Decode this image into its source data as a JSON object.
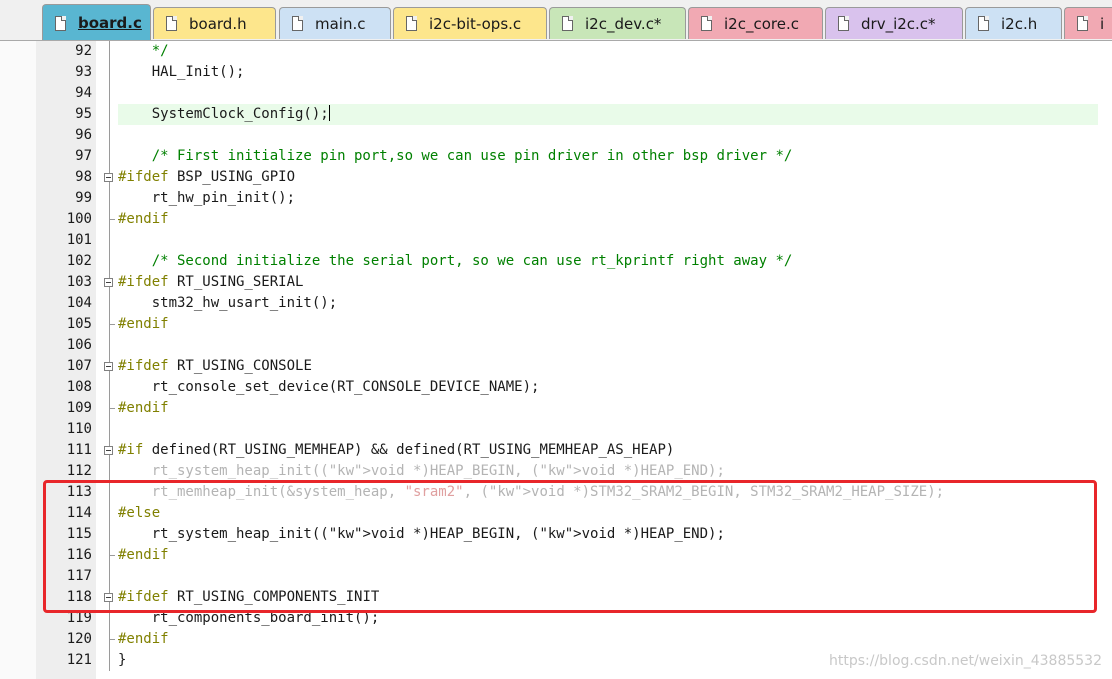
{
  "tabs": [
    {
      "label": "board.c",
      "active": true,
      "color": "#59b6d1"
    },
    {
      "label": "board.h",
      "active": false,
      "color": "#fde68c"
    },
    {
      "label": "main.c",
      "active": false,
      "color": "#cde1f4"
    },
    {
      "label": "i2c-bit-ops.c",
      "active": false,
      "color": "#fde68c"
    },
    {
      "label": "i2c_dev.c*",
      "active": false,
      "color": "#c8e6b8"
    },
    {
      "label": "i2c_core.c",
      "active": false,
      "color": "#f1a9b3"
    },
    {
      "label": "drv_i2c.c*",
      "active": false,
      "color": "#d9c2ed"
    },
    {
      "label": "i2c.h",
      "active": false,
      "color": "#cde1f4"
    },
    {
      "label": "i",
      "active": false,
      "color": "#f1a9b3"
    }
  ],
  "lines": [
    {
      "n": "92",
      "code": "    */"
    },
    {
      "n": "93",
      "code": "    HAL_Init();"
    },
    {
      "n": "94",
      "code": ""
    },
    {
      "n": "95",
      "code": "    SystemClock_Config();"
    },
    {
      "n": "96",
      "code": ""
    },
    {
      "n": "97",
      "code": "    /* First initialize pin port,so we can use pin driver in other bsp driver */"
    },
    {
      "n": "98",
      "code": "#ifdef BSP_USING_GPIO"
    },
    {
      "n": "99",
      "code": "    rt_hw_pin_init();"
    },
    {
      "n": "100",
      "code": "#endif"
    },
    {
      "n": "101",
      "code": ""
    },
    {
      "n": "102",
      "code": "    /* Second initialize the serial port, so we can use rt_kprintf right away */"
    },
    {
      "n": "103",
      "code": "#ifdef RT_USING_SERIAL"
    },
    {
      "n": "104",
      "code": "    stm32_hw_usart_init();"
    },
    {
      "n": "105",
      "code": "#endif"
    },
    {
      "n": "106",
      "code": ""
    },
    {
      "n": "107",
      "code": "#ifdef RT_USING_CONSOLE"
    },
    {
      "n": "108",
      "code": "    rt_console_set_device(RT_CONSOLE_DEVICE_NAME);"
    },
    {
      "n": "109",
      "code": "#endif"
    },
    {
      "n": "110",
      "code": ""
    },
    {
      "n": "111",
      "code": "#if defined(RT_USING_MEMHEAP) && defined(RT_USING_MEMHEAP_AS_HEAP)"
    },
    {
      "n": "112",
      "code": "    rt_system_heap_init((void *)HEAP_BEGIN, (void *)HEAP_END);"
    },
    {
      "n": "113",
      "code": "    rt_memheap_init(&system_heap, \"sram2\", (void *)STM32_SRAM2_BEGIN, STM32_SRAM2_HEAP_SIZE);"
    },
    {
      "n": "114",
      "code": "#else"
    },
    {
      "n": "115",
      "code": "    rt_system_heap_init((void *)HEAP_BEGIN, (void *)HEAP_END);"
    },
    {
      "n": "116",
      "code": "#endif"
    },
    {
      "n": "117",
      "code": ""
    },
    {
      "n": "118",
      "code": "#ifdef RT_USING_COMPONENTS_INIT"
    },
    {
      "n": "119",
      "code": "    rt_components_board_init();"
    },
    {
      "n": "120",
      "code": "#endif"
    },
    {
      "n": "121",
      "code": "}"
    }
  ],
  "watermark": "https://blog.csdn.net/weixin_43885532",
  "colors": {
    "comment": "#008000",
    "preprocessor": "#808000",
    "keyword": "#0000ff",
    "string": "#a31515",
    "inactive": "#b4b4b4",
    "current_line": "#e9fbe9",
    "highlight_box": "#e8262a"
  }
}
